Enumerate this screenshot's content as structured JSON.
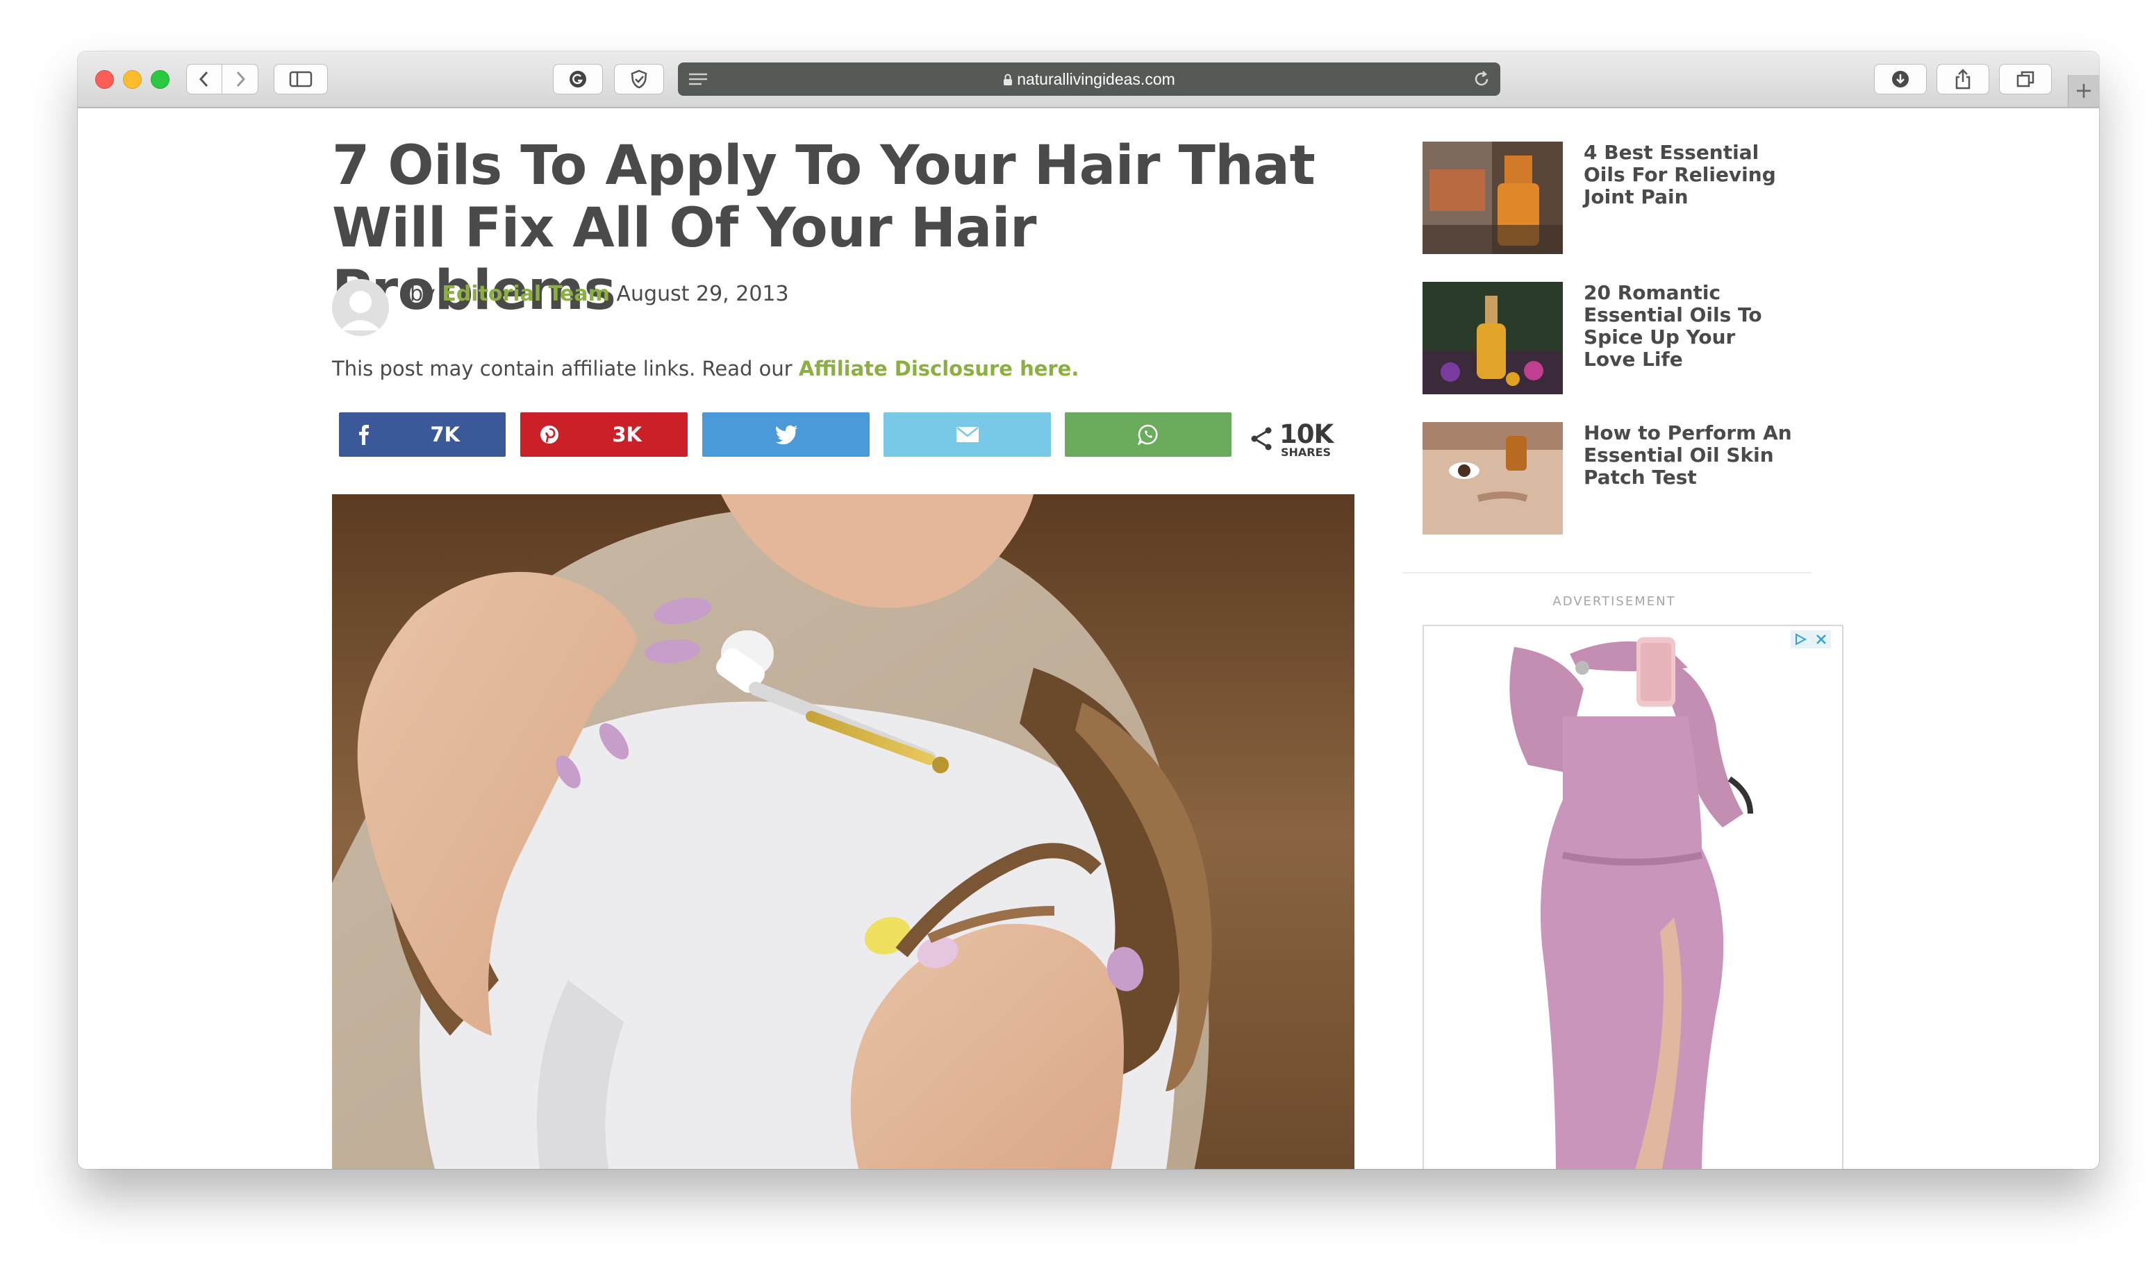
{
  "browser": {
    "url": "naturallivingideas.com"
  },
  "article": {
    "title": "7 Oils To Apply To Your Hair That Will Fix All Of Your Hair Problems",
    "byline_prefix": "by",
    "author": "Editorial Team",
    "date": "August 29, 2013",
    "disclosure_text": "This post may contain affiliate links. Read our",
    "disclosure_link": "Affiliate Disclosure here."
  },
  "share": {
    "facebook_count": "7K",
    "pinterest_count": "3K",
    "total_count": "10K",
    "total_label": "SHARES"
  },
  "colors": {
    "facebook": "#3b5998",
    "pinterest": "#cb2027",
    "twitter": "#4a99d8",
    "email": "#78c8e8",
    "whatsapp": "#6aac5c",
    "accent_green": "#8bb03f"
  },
  "sidebar": {
    "related": [
      {
        "title": "4 Best Essential Oils For Relieving Joint Pain"
      },
      {
        "title": "20 Romantic Essential Oils To Spice Up Your Love Life"
      },
      {
        "title": "How to Perform An Essential Oil Skin Patch Test"
      }
    ],
    "ad_label": "ADVERTISEMENT"
  }
}
